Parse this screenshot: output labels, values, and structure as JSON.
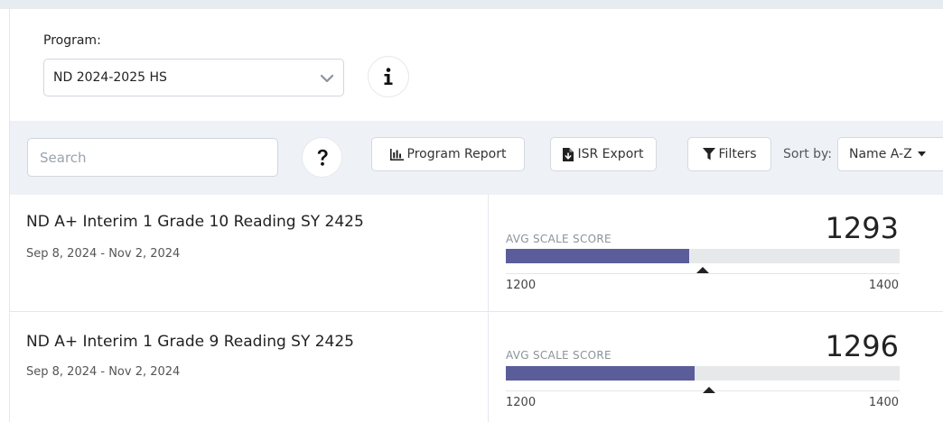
{
  "program": {
    "label": "Program:",
    "selected": "ND 2024-2025 HS"
  },
  "toolbar": {
    "search_placeholder": "Search",
    "program_report_label": "Program Report",
    "isr_export_label": "ISR Export",
    "filters_label": "Filters",
    "sort_label": "Sort by:",
    "sort_value": "Name A-Z"
  },
  "assessments": [
    {
      "title": "ND A+ Interim 1 Grade 10 Reading SY 2425",
      "dates": "Sep 8, 2024 - Nov 2, 2024",
      "score_label": "AVG SCALE SCORE",
      "score": 1293,
      "range_min": "1200",
      "range_max": "1400",
      "score_display": "1293",
      "marker_value": 1300
    },
    {
      "title": "ND A+ Interim 1 Grade 9 Reading SY 2425",
      "dates": "Sep 8, 2024 - Nov 2, 2024",
      "score_label": "AVG SCALE SCORE",
      "score": 1296,
      "range_min": "1200",
      "range_max": "1400",
      "score_display": "1296",
      "marker_value": 1303
    }
  ],
  "colors": {
    "bar_fill": "#5b5d9b",
    "bar_track": "#e6e8ea",
    "toolbar_bg": "#eef2f6"
  },
  "icons": {
    "program_dropdown": "chevron-down-icon",
    "info": "info-icon",
    "help": "question-icon",
    "program_report": "bar-chart-icon",
    "isr_export": "file-download-icon",
    "filters": "filter-icon",
    "sort": "caret-down-icon"
  }
}
